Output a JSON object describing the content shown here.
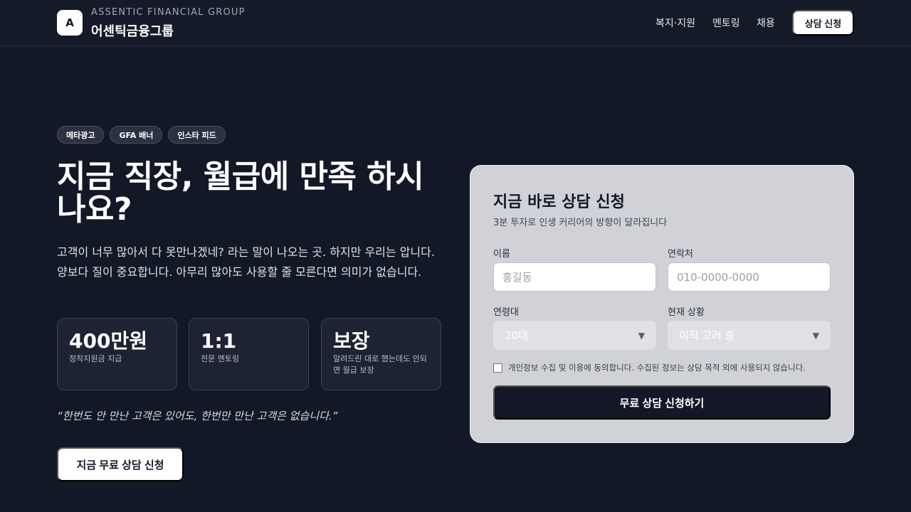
{
  "header": {
    "logo_letter": "A",
    "brand_en": "ASSENTIC FINANCIAL GROUP",
    "brand_ko": "어센틱금융그룹",
    "nav": [
      {
        "label": "복지·지원"
      },
      {
        "label": "멘토링"
      },
      {
        "label": "채용"
      }
    ],
    "cta_label": "상담 신청"
  },
  "hero": {
    "chips": [
      "메타광고",
      "GFA 배너",
      "인스타 피드"
    ],
    "headline": "지금 직장, 월급에 만족 하시나요?",
    "description": "고객이 너무 많아서 다 못만나겠네? 라는 말이 나오는 곳. 하지만 우리는 압니다. 양보다 질이 중요합니다. 아무리 많아도 사용할 줄 모른다면 의미가 없습니다.",
    "stats": [
      {
        "value": "400만원",
        "label": "정착지원금 지급"
      },
      {
        "value": "1:1",
        "label": "전문 멘토링"
      },
      {
        "value": "보장",
        "label": "알려드린 대로 했는데도 안되면 월급 보장"
      }
    ],
    "quote": "“한번도 안 만난 고객은 있어도, 한번만 만난 고객은 없습니다.”",
    "cta_label": "지금 무료 상담 신청"
  },
  "form": {
    "title": "지금 바로 상담 신청",
    "subtitle": "3분 투자로 인생 커리어의 방향이 달라집니다",
    "name_label": "이름",
    "name_placeholder": "홍길동",
    "phone_label": "연락처",
    "phone_placeholder": "010-0000-0000",
    "age_label": "연령대",
    "age_value": "20대",
    "status_label": "현재 상황",
    "status_value": "이직 고려 중",
    "consent_text": "개인정보 수집 및 이용에 동의합니다. 수집된 정보는 상담 목적 외에 사용되지 않습니다.",
    "consent_checked": false,
    "submit_label": "무료 상담 신청하기"
  },
  "colors": {
    "background": "#131827",
    "card": "#d1d2d7",
    "primary_dark": "#131827",
    "white": "#ffffff"
  }
}
